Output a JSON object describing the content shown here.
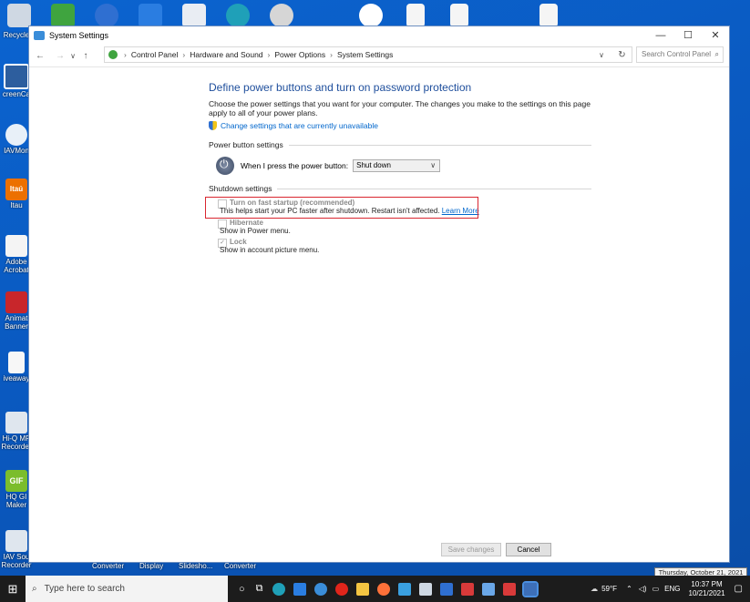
{
  "desktop": {
    "icons": [
      {
        "label": "Recycle"
      },
      {
        "label": "creenCa"
      },
      {
        "label": "IAVMon"
      },
      {
        "label": "Itau"
      },
      {
        "label": "Adobe"
      },
      {
        "label": "Acrobat"
      },
      {
        "label": "Animat"
      },
      {
        "label": "Banner"
      },
      {
        "label": "iveaway"
      },
      {
        "label": "Hi-Q MP"
      },
      {
        "label": "Recorder"
      },
      {
        "label": "HQ GI"
      },
      {
        "label": "Maker"
      },
      {
        "label": "IAV Sou"
      },
      {
        "label": "Recorder"
      }
    ],
    "itau_badge": "Itaú",
    "gif_badge": "GIF",
    "bottom_labels": [
      "Converter",
      "Display",
      "Slidesho...",
      "Converter"
    ]
  },
  "window": {
    "title": "System Settings",
    "minimize": "—",
    "maximize": "☐",
    "close": "✕",
    "nav": {
      "back": "←",
      "forward": "→",
      "recent": "∨",
      "up": "↑"
    },
    "breadcrumbs": [
      "Control Panel",
      "Hardware and Sound",
      "Power Options",
      "System Settings"
    ],
    "breadcrumb_sep": "›",
    "dropdown_chevron": "∨",
    "refresh": "↻",
    "search_placeholder": "Search Control Panel",
    "heading": "Define power buttons and turn on password protection",
    "description": "Choose the power settings that you want for your computer. The changes you make to the settings on this page apply to all of your power plans.",
    "change_link": "Change settings that are currently unavailable",
    "power_button_section": "Power button settings",
    "power_button_label": "When I press the power button:",
    "power_button_value": "Shut down",
    "shutdown_section": "Shutdown settings",
    "options": [
      {
        "title": "Turn on fast startup (recommended)",
        "desc": "This helps start your PC faster after shutdown. Restart isn't affected.",
        "link": "Learn More",
        "checked": false
      },
      {
        "title": "Hibernate",
        "desc": "Show in Power menu.",
        "checked": false
      },
      {
        "title": "Lock",
        "desc": "Show in account picture menu.",
        "checked": true
      }
    ],
    "check_mark": "✓",
    "save_button": "Save changes",
    "cancel_button": "Cancel"
  },
  "taskbar": {
    "search_placeholder": "Type here to search",
    "temperature": "59°F",
    "language": "ENG",
    "time": "10:37 PM",
    "date": "10/21/2021",
    "tooltip": "Thursday, October 21, 2021"
  },
  "colors": {
    "accent": "#0066cc",
    "heading": "#1e4e9c",
    "highlight": "#d9262f",
    "desktop": "#0a5bc4"
  }
}
